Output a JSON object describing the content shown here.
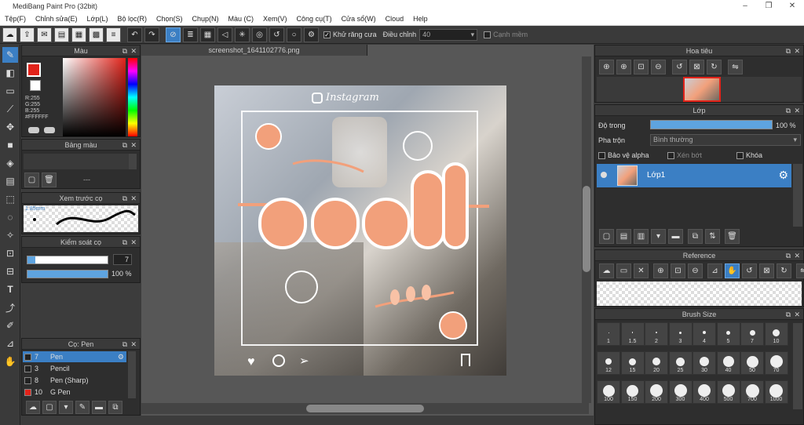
{
  "window": {
    "title": "MediBang Paint Pro (32bit)"
  },
  "menu": [
    "Tệp(F)",
    "Chỉnh sửa(E)",
    "Lớp(L)",
    "Bộ lọc(R)",
    "Chọn(S)",
    "Chụp(N)",
    "Màu (C)",
    "Xem(V)",
    "Công cụ(T)",
    "Cửa sổ(W)",
    "Cloud",
    "Help"
  ],
  "toolbar": {
    "antialias_label": "Khử răng cưa",
    "adjust_label": "Điều chỉnh",
    "adjust_value": "40",
    "snap_label": "Cạnh mềm"
  },
  "color_panel": {
    "title": "Màu",
    "rgb": [
      "R:255",
      "G:255",
      "B:255"
    ],
    "hex": "#FFFFFF",
    "fg": "#e2231a",
    "bg": "#ffffff"
  },
  "palette_panel": {
    "title": "Bảng màu",
    "dash": "---"
  },
  "preview_panel": {
    "title": "Xem trước cọ",
    "size": "1.85mm"
  },
  "control_panel": {
    "title": "Kiểm soát cọ",
    "size": "7",
    "opacity": "100 %"
  },
  "brush_panel": {
    "title": "Cọ: Pen",
    "items": [
      {
        "num": "7",
        "name": "Pen",
        "color": "#222222"
      },
      {
        "num": "3",
        "name": "Pencil",
        "color": "#222222"
      },
      {
        "num": "8",
        "name": "Pen (Sharp)",
        "color": "#222222"
      },
      {
        "num": "10",
        "name": "G Pen",
        "color": "#e2231a"
      }
    ]
  },
  "document": {
    "tab": "screenshot_1641102776.png",
    "instagram": "Instagram"
  },
  "navigator": {
    "title": "Hoa tiêu"
  },
  "layer_panel": {
    "title": "Lớp",
    "opacity_label": "Độ trong",
    "opacity_value": "100 %",
    "blend_label": "Pha trộn",
    "blend_value": "Bình thường",
    "protect_alpha": "Bảo vệ alpha",
    "clipping": "Xén bớt",
    "lock": "Khóa",
    "layer_name": "Lớp1"
  },
  "reference": {
    "title": "Reference"
  },
  "brush_size": {
    "title": "Brush Size",
    "sizes": [
      "1",
      "1.5",
      "2",
      "3",
      "4",
      "5",
      "7",
      "10",
      "12",
      "15",
      "20",
      "25",
      "30",
      "40",
      "50",
      "70",
      "100",
      "150",
      "200",
      "300",
      "400",
      "500",
      "700",
      "1000"
    ]
  }
}
